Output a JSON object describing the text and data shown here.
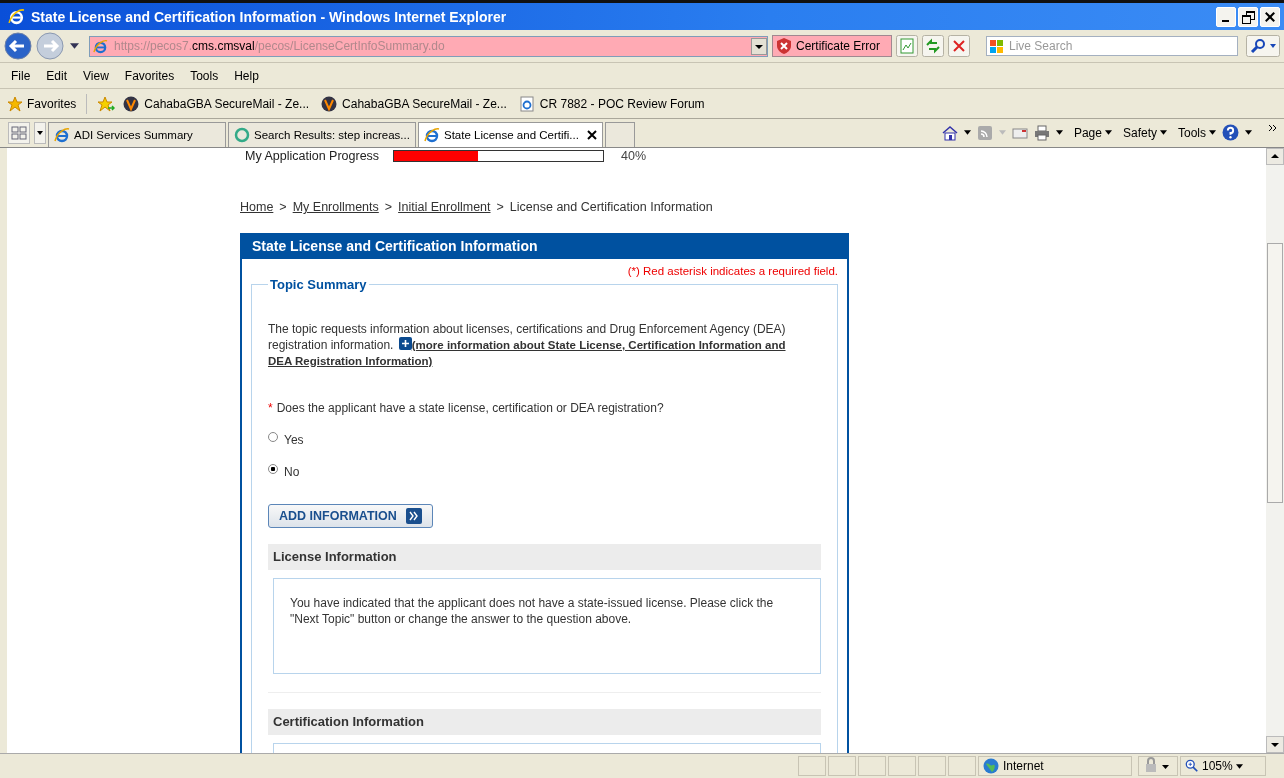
{
  "window": {
    "title": "State License and Certification Information - Windows Internet Explorer"
  },
  "address_bar": {
    "url_prefix": "https://pecos7.",
    "url_host": "cms.cmsval",
    "url_path": "/pecos/LicenseCertInfoSummary.do",
    "certificate_error": "Certificate Error"
  },
  "search": {
    "placeholder": "Live Search"
  },
  "menu": [
    "File",
    "Edit",
    "View",
    "Favorites",
    "Tools",
    "Help"
  ],
  "favorites_bar": {
    "label": "Favorites",
    "items": [
      {
        "label": "CahabaGBA SecureMail - Ze...",
        "kind": "v"
      },
      {
        "label": "CahabaGBA SecureMail - Ze...",
        "kind": "v"
      },
      {
        "label": "CR 7882 - POC Review Forum",
        "kind": "page"
      }
    ]
  },
  "tabs": [
    {
      "label": "ADI Services Summary",
      "selected": false,
      "kind": "ie"
    },
    {
      "label": "Search Results: step increas...",
      "selected": false,
      "kind": "ring"
    },
    {
      "label": "State License and Certifi...",
      "selected": true,
      "kind": "ie"
    }
  ],
  "command_bar": [
    "Page",
    "Safety",
    "Tools"
  ],
  "page": {
    "progress": {
      "label": "My Application Progress",
      "level": 0.4,
      "reading": "40%"
    },
    "breadcrumb": [
      {
        "label": "Home",
        "link": true
      },
      {
        "separator": ">",
        "label": "My Enrollments",
        "link": true
      },
      {
        "separator": ">",
        "label": "Initial Enrollment",
        "link": true
      },
      {
        "separator": ">",
        "label": "License and Certification Information",
        "link": false
      }
    ],
    "panel": {
      "title": "State License and Certification Information",
      "required_note": "(*) Red asterisk indicates a required field.",
      "topic": {
        "legend": "Topic Summary",
        "intro": "The topic requests information about licenses, certifications and Drug Enforcement Agency (DEA) registration information.",
        "more_link": [
          "(more information about State License, Certification Information and",
          "DEA Registration Information)"
        ],
        "question": "Does the applicant have a state license, certification or DEA registration?",
        "required_mark": "*",
        "options": [
          {
            "label": "Yes",
            "selected": false
          },
          {
            "label": "No",
            "selected": true
          }
        ],
        "add_button": "ADD INFORMATION",
        "sections": [
          {
            "title": "License Information",
            "message": "You have indicated that the applicant does not have a state-issued license. Please click the \"Next Topic\" button or change the answer to the question above."
          },
          {
            "title": "Certification Information"
          }
        ]
      }
    }
  },
  "status_bar": {
    "zone": "Internet",
    "zoom": "105%"
  }
}
